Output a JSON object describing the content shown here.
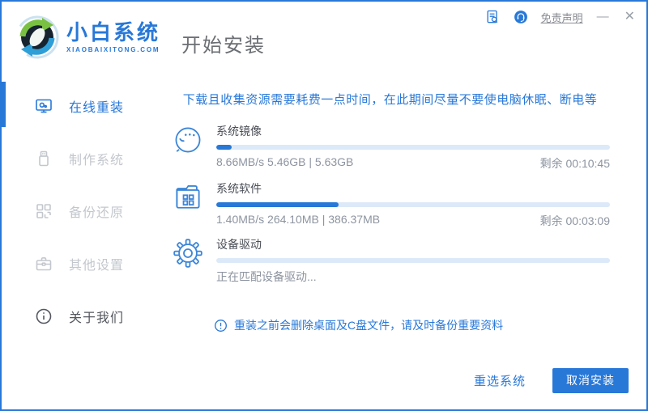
{
  "colors": {
    "accent": "#2878d8",
    "progress_track": "#dce9f8",
    "inactive_gray": "#c3c7cd",
    "stat_gray": "#8d94a0"
  },
  "header": {
    "brand_name": "小白系统",
    "brand_domain": "XIAOBAIXITONG.COM",
    "page_title": "开始安装",
    "disclaimer_link": "免责声明",
    "minimize_glyph": "—",
    "close_glyph": "✕",
    "icon_names": [
      "logo-refresh-icon",
      "document-search-icon",
      "customer-service-icon"
    ]
  },
  "sidebar": {
    "items": [
      {
        "label": "在线重装",
        "icon": "monitor-icon",
        "active": true
      },
      {
        "label": "制作系统",
        "icon": "usb-drive-icon",
        "active": false
      },
      {
        "label": "备份还原",
        "icon": "backup-grid-icon",
        "active": false
      },
      {
        "label": "其他设置",
        "icon": "briefcase-icon",
        "active": false
      },
      {
        "label": "关于我们",
        "icon": "info-circle-icon",
        "active": false
      }
    ]
  },
  "main": {
    "warning": "下载且收集资源需要耗费一点时间，在此期间尽量不要使电脑休眠、断电等",
    "tasks": [
      {
        "label": "系统镜像",
        "icon": "face-chat-icon",
        "progress_pct": 4,
        "stats": "8.66MB/s 5.46GB | 5.63GB",
        "remaining": "剩余 00:10:45"
      },
      {
        "label": "系统软件",
        "icon": "folder-apps-icon",
        "progress_pct": 31,
        "stats": "1.40MB/s 264.10MB | 386.37MB",
        "remaining": "剩余 00:03:09"
      },
      {
        "label": "设备驱动",
        "icon": "gear-icon",
        "progress_pct": 0,
        "status": "正在匹配设备驱动..."
      }
    ],
    "note": "重装之前会删除桌面及C盘文件，请及时备份重要资料"
  },
  "footer": {
    "reselect_label": "重选系统",
    "cancel_label": "取消安装"
  }
}
